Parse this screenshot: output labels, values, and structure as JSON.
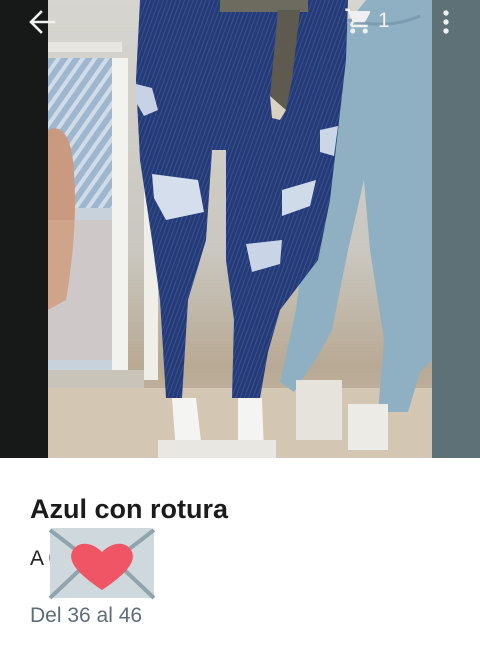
{
  "app_bar": {
    "back_icon": "arrow-left-icon",
    "cart_icon": "shopping-cart-icon",
    "cart_count": "1",
    "menu_icon": "more-vert-icon"
  },
  "product": {
    "image_alt": "Azul con rotura",
    "title": "Azul con rotura",
    "price": "A                   0",
    "sizes": "Del 36 al 46",
    "overlay_sticker_icon": "heart-envelope-icon"
  },
  "colors": {
    "title": "#1b1b1b",
    "sizes_text": "#5d6d78",
    "heart": "#ef5565",
    "envelope": "#cfd8dc"
  }
}
